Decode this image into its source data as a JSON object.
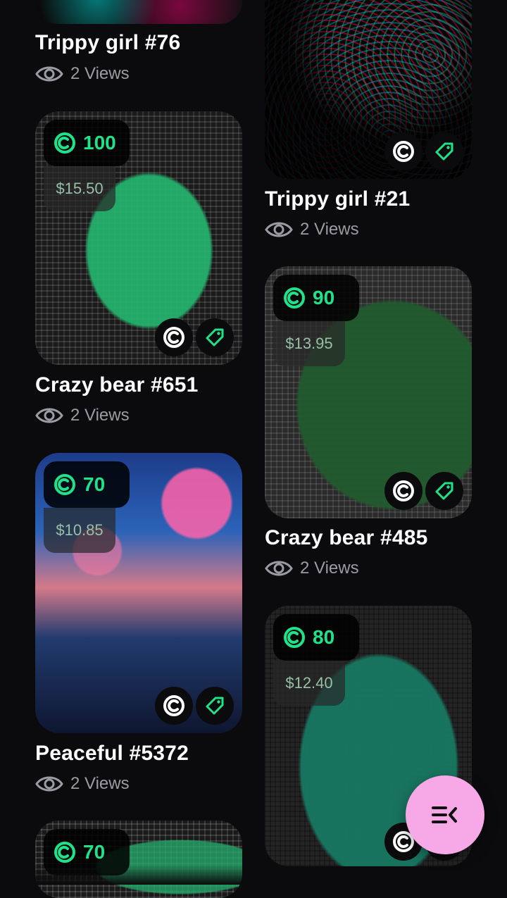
{
  "cards": {
    "trippy_girl_76": {
      "title": "Trippy girl #76",
      "views": "2 Views"
    },
    "trippy_girl_21": {
      "title": "Trippy girl #21",
      "views": "2 Views"
    },
    "crazy_bear_651": {
      "title": "Crazy bear #651",
      "views": "2 Views",
      "points": "100",
      "price": "$15.50"
    },
    "crazy_bear_485": {
      "title": "Crazy bear #485",
      "views": "2 Views",
      "points": "90",
      "price": "$13.95"
    },
    "peaceful_5372": {
      "title": "Peaceful #5372",
      "views": "2 Views",
      "points": "70",
      "price": "$10.85"
    },
    "bear_80": {
      "points": "80",
      "price": "$12.40"
    },
    "partial_70": {
      "points": "70"
    }
  },
  "icons": {
    "views": "eye-icon",
    "points": "coin-c-icon",
    "action_1": "copyright-icon",
    "action_2": "tag-icon",
    "fab": "menu-collapse-icon"
  },
  "colors": {
    "background": "#0b0b0e",
    "accent_green": "#1fe38a",
    "price_text": "#98bfa7",
    "fab_bg": "#f7a8e6"
  }
}
